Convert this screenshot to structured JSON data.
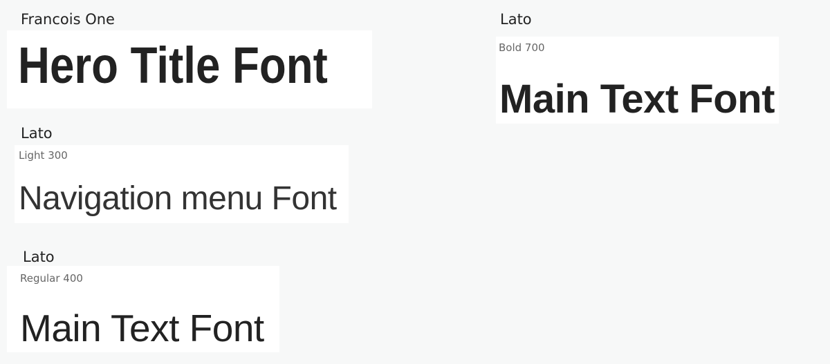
{
  "fonts": [
    {
      "family": "Francois One",
      "weight_label": "",
      "sample": "Hero Title Font"
    },
    {
      "family": "Lato",
      "weight_label": "Bold 700",
      "sample": "Main Text Font"
    },
    {
      "family": "Lato",
      "weight_label": "Light 300",
      "sample": "Navigation menu Font"
    },
    {
      "family": "Lato",
      "weight_label": "Regular 400",
      "sample": "Main Text Font"
    }
  ],
  "colors": {
    "background": "#f7f8f8",
    "card": "#ffffff",
    "text": "#222222",
    "muted_label": "#666666"
  }
}
